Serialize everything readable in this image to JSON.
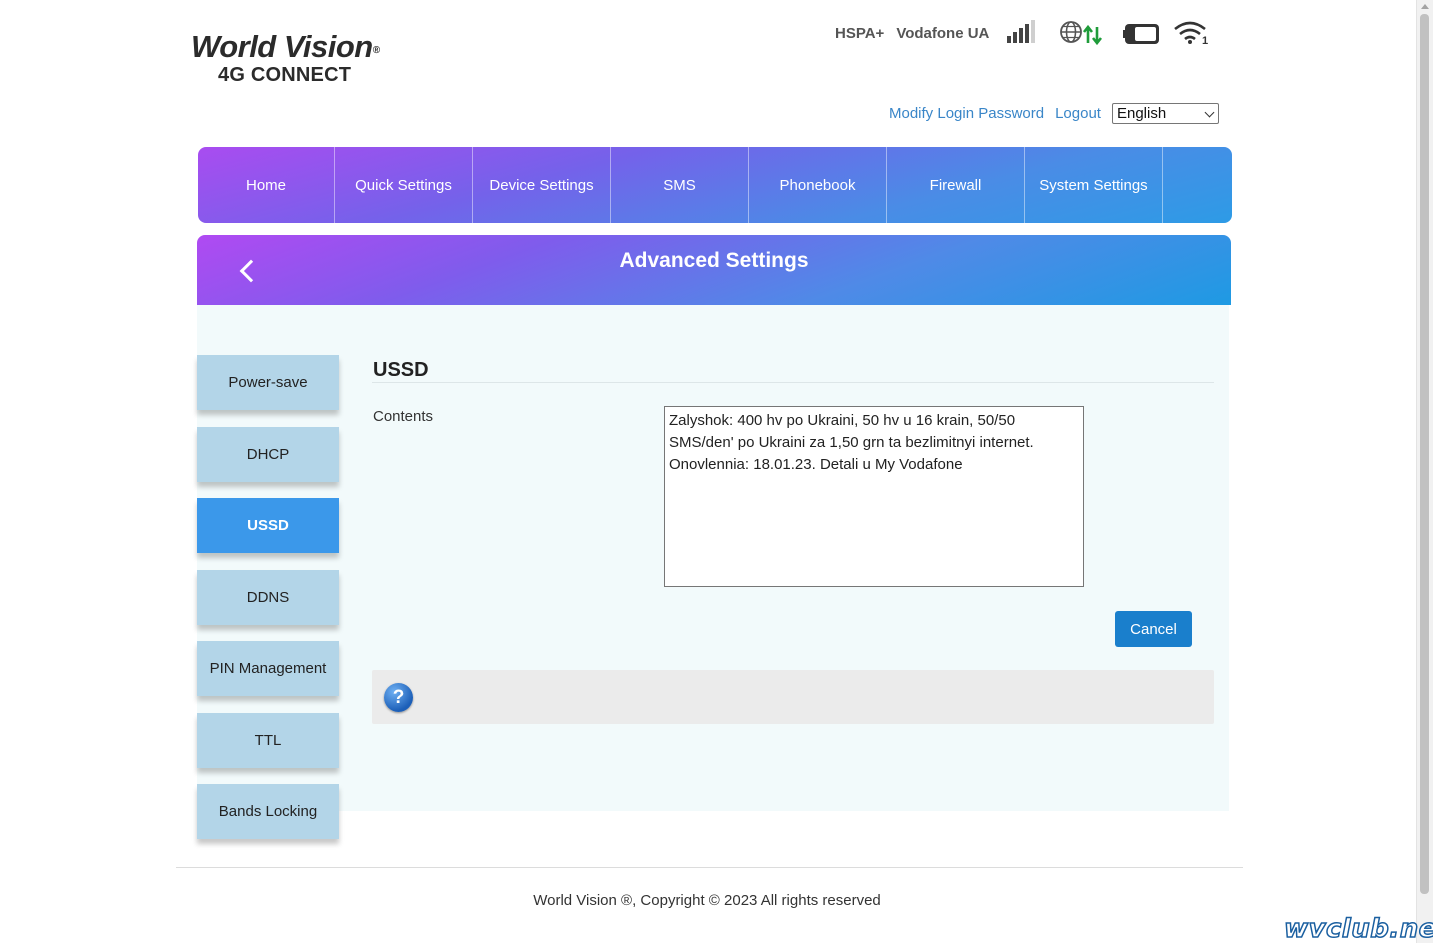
{
  "brand": {
    "name": "World Vision",
    "registered": "®",
    "subtitle": "4G CONNECT"
  },
  "status": {
    "network_type": "HSPA+",
    "operator": "Vodafone UA",
    "signal_bars": 4,
    "data_arrows": "⇅",
    "wifi_clients": "1"
  },
  "top_links": {
    "modify_password": "Modify Login Password",
    "logout": "Logout",
    "language_selected": "English"
  },
  "nav": {
    "items": [
      {
        "label": "Home"
      },
      {
        "label": "Quick Settings"
      },
      {
        "label": "Device Settings"
      },
      {
        "label": "SMS"
      },
      {
        "label": "Phonebook"
      },
      {
        "label": "Firewall"
      },
      {
        "label": "System Settings"
      }
    ]
  },
  "section": {
    "title": "Advanced Settings"
  },
  "sidebar": {
    "items": [
      {
        "label": "Power-save"
      },
      {
        "label": "DHCP"
      },
      {
        "label": "USSD",
        "active": true
      },
      {
        "label": "DDNS"
      },
      {
        "label": "PIN Management"
      },
      {
        "label": "TTL"
      },
      {
        "label": "Bands Locking"
      }
    ]
  },
  "panel": {
    "title": "USSD",
    "contents_label": "Contents",
    "contents_lines": [
      "Zalyshok: 400 hv po Ukraini, 50 hv u 16 krain, 50/50",
      "SMS/den' po Ukraini za 1,50 grn ta bezlimitnyi internet.",
      "Onovlennia: 18.01.23. Detali u My Vodafone"
    ],
    "cancel_label": "Cancel",
    "help_glyph": "?"
  },
  "footer": {
    "copyright": "World Vision ®, Copyright © 2023 All rights reserved"
  },
  "watermark": "wvclub.net",
  "colors": {
    "accent": "#3b98ea",
    "sidebar": "#b3d5e8",
    "button": "#1a7fcc",
    "link": "#3a86c8"
  }
}
